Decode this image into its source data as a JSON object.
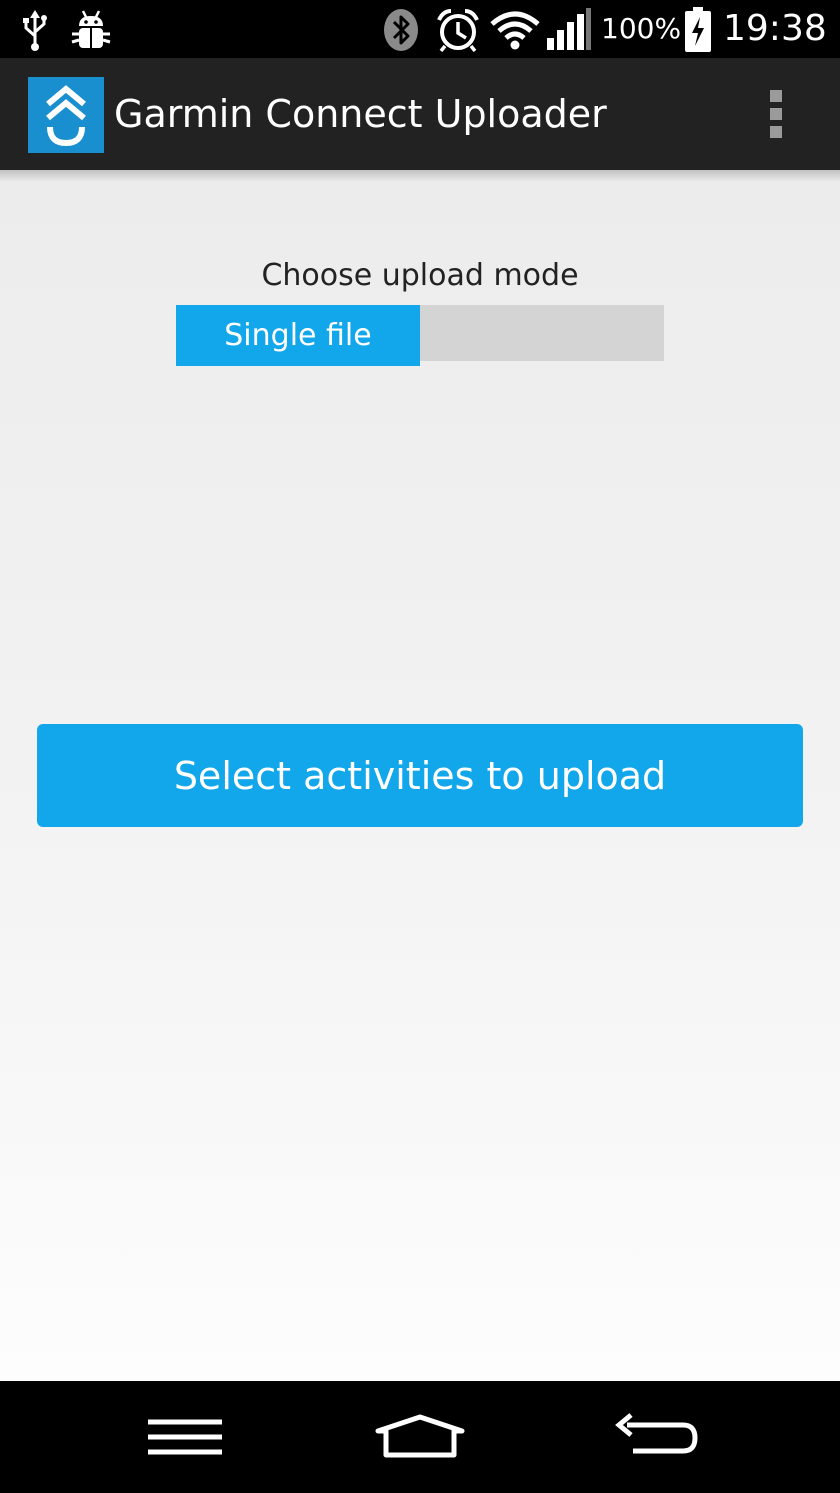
{
  "status_bar": {
    "icons": [
      "usb-icon",
      "android-debug-icon",
      "bluetooth-icon",
      "alarm-icon",
      "wifi-icon",
      "signal-icon",
      "battery-charging-icon"
    ],
    "battery_percent": "100%",
    "time": "19:38"
  },
  "action_bar": {
    "app_icon": "garmin-connect-uploader-logo",
    "title": "Garmin Connect Uploader",
    "overflow_icon": "overflow-menu-icon"
  },
  "upload_mode": {
    "label": "Choose upload mode",
    "selected_option": "Single file"
  },
  "main_button": {
    "label": "Select activities to upload"
  },
  "nav_bar": {
    "icons": [
      "menu-icon",
      "home-icon",
      "back-icon"
    ]
  },
  "colors": {
    "accent": "#12a6ea",
    "action_bar": "#222222",
    "logo_bg": "#1a8fcf",
    "toggle_off": "#d4d4d4"
  }
}
